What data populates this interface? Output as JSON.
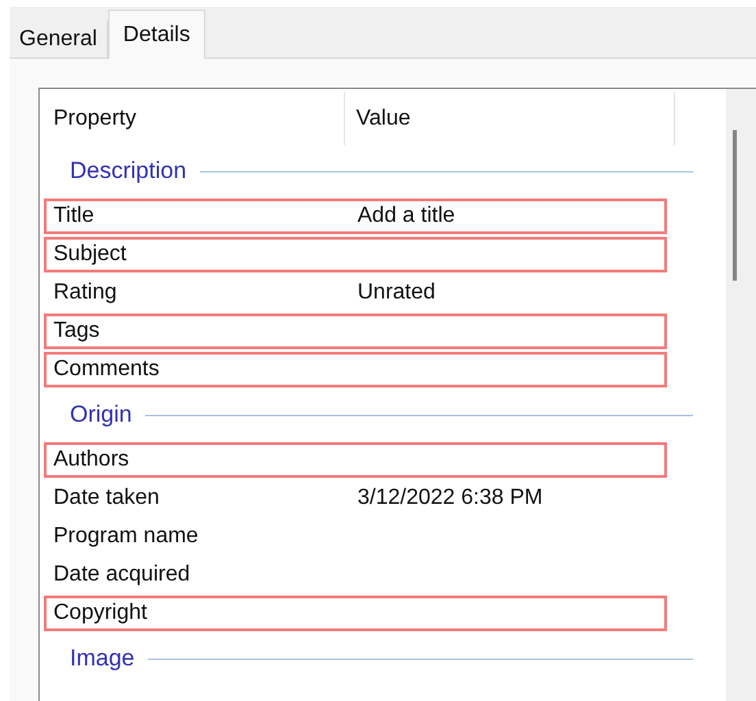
{
  "tabs": [
    {
      "label": "General",
      "selected": false
    },
    {
      "label": "Details",
      "selected": true
    }
  ],
  "columns": [
    "Property",
    "Value"
  ],
  "groups": [
    {
      "heading": "Description",
      "rows": [
        {
          "property": "Title",
          "value": "Add a title",
          "highlighted": true
        },
        {
          "property": "Subject",
          "highlighted": true
        },
        {
          "property": "Rating",
          "value": "Unrated",
          "highlighted": false
        },
        {
          "property": "Tags",
          "highlighted": true
        },
        {
          "property": "Comments",
          "highlighted": true
        }
      ]
    },
    {
      "heading": "Origin",
      "rows": [
        {
          "property": "Authors",
          "highlighted": true
        },
        {
          "property": "Date taken",
          "value": "3/12/2022 6:38 PM",
          "highlighted": false
        },
        {
          "property": "Program name",
          "highlighted": false
        },
        {
          "property": "Date acquired",
          "highlighted": false
        },
        {
          "property": "Copyright",
          "highlighted": true
        }
      ]
    },
    {
      "heading": "Image"
    }
  ]
}
